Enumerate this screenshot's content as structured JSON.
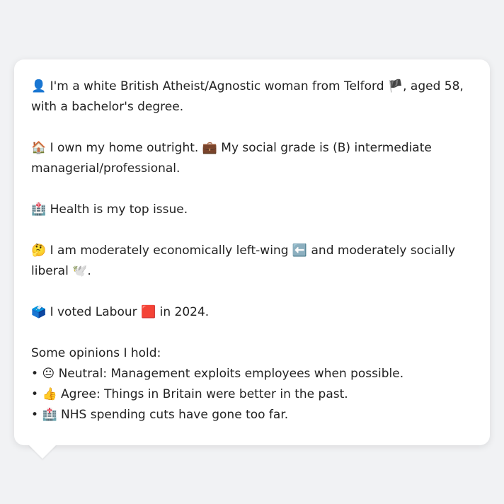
{
  "lines": {
    "identity_icon": "👤",
    "identity_text": " I'm a white British Atheist/Agnostic woman from Telford ",
    "flag_icon": "🏴",
    "identity_text2": ", aged 58, with a bachelor's degree.",
    "home_icon": "🏠",
    "home_text": " I own my home outright. ",
    "briefcase_icon": "💼",
    "grade_text": " My social grade is (B) intermediate managerial/professional.",
    "hospital_icon": "🏥",
    "health_text": " Health is my top issue.",
    "thinking_icon": "🤔",
    "econ_text": " I am moderately economically left-wing ",
    "left_arrow_icon": "⬅️",
    "social_text": " and moderately socially liberal ",
    "dove_icon": "🕊️",
    "social_end": ".",
    "ballot_icon": "🗳️",
    "vote_text": " I voted Labour ",
    "red_square_icon": "🟥",
    "vote_end": " in 2024."
  },
  "opinions_header": "Some opinions I hold:",
  "opinions": [
    {
      "bullet": "• ",
      "icon": "😐",
      "text": " Neutral: Management exploits employees when possible."
    },
    {
      "bullet": "• ",
      "icon": "👍",
      "text": " Agree: Things in Britain were better in the past."
    },
    {
      "bullet": "• ",
      "icon": "🏥",
      "text": " NHS spending cuts have gone too far."
    }
  ]
}
